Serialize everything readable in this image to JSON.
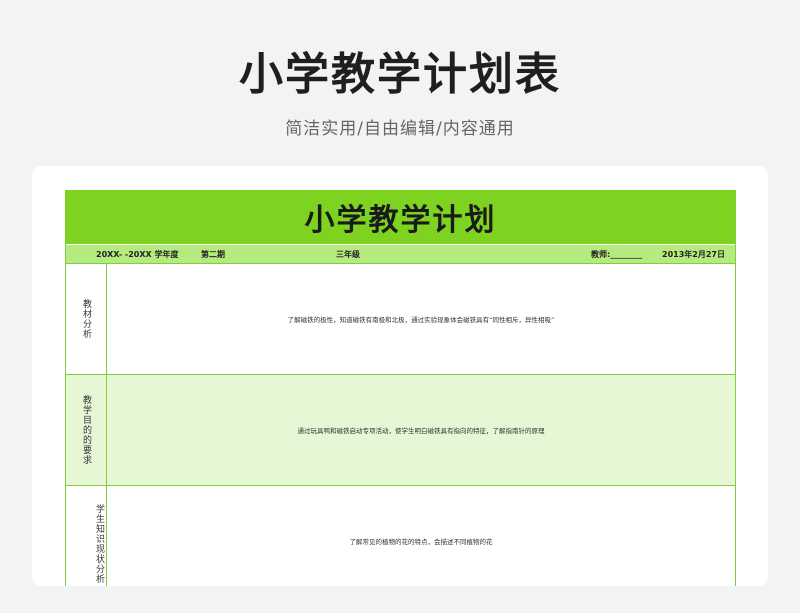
{
  "header": {
    "title": "小学教学计划表",
    "subtitle": "简洁实用/自由编辑/内容通用"
  },
  "sheet": {
    "title": "小学教学计划",
    "info": {
      "year": "20XX- -20XX 学年度",
      "term": "第二期",
      "grade": "三年级",
      "teacher": "教师:________",
      "date": "2013年2月27日"
    },
    "rows": [
      {
        "label": "教材分析",
        "content": "了解磁铁的极性，知道磁铁有南极和北极，通过实验现象体会磁铁具有“同性相斥，异性相吸”"
      },
      {
        "label": "教学目的的要求",
        "content": "通过玩具鸭和磁铁启动专项活动，使学生明白磁铁具有指向的特征，了解指南针的原理"
      },
      {
        "label": "学生知识现状分析",
        "content": "了解常见的植物的花的特点，会描述不同植物的花"
      }
    ]
  },
  "colors": {
    "banner": "#7ed321",
    "info_row": "#b5eb7e",
    "alt_row": "#e6f7d6",
    "border": "#7fcf3d"
  }
}
